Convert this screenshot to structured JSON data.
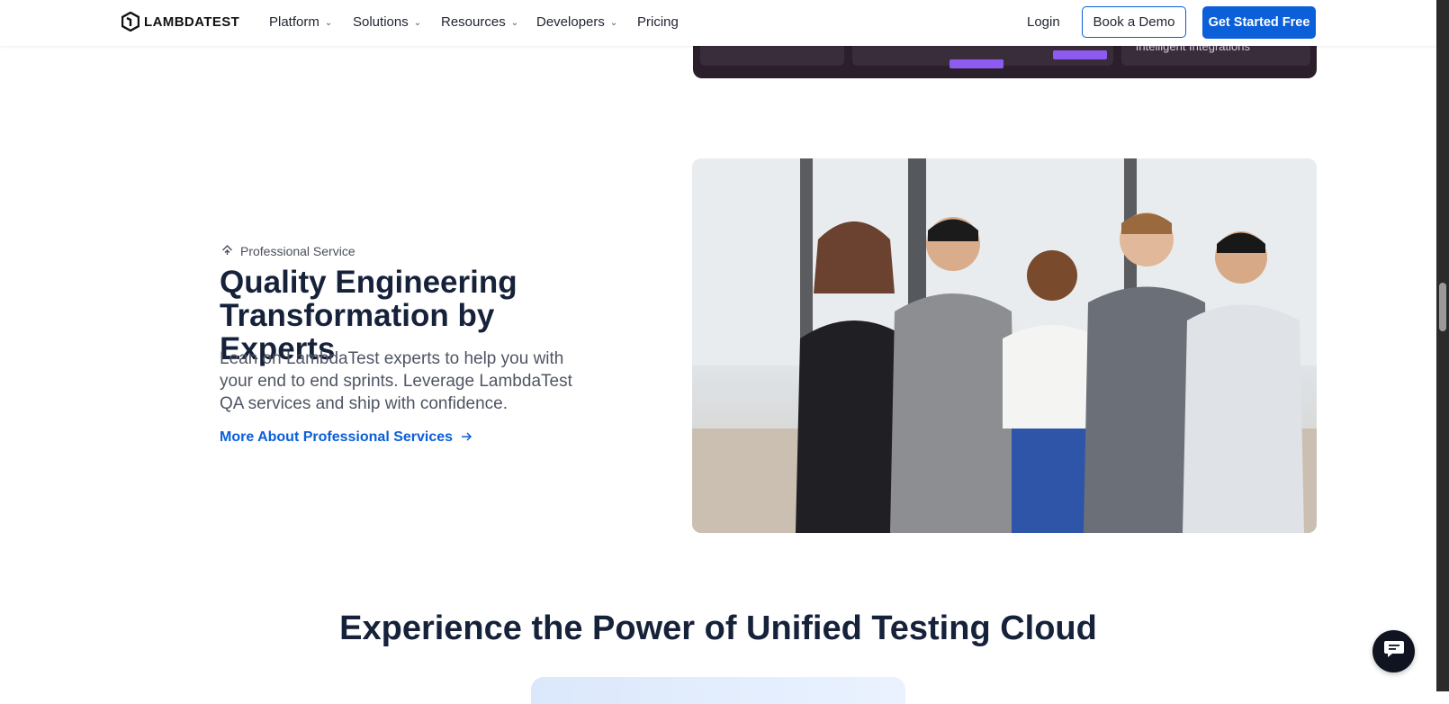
{
  "brand": {
    "name": "LAMBDATEST"
  },
  "nav": {
    "items": [
      {
        "label": "Platform",
        "has_dropdown": true
      },
      {
        "label": "Solutions",
        "has_dropdown": true
      },
      {
        "label": "Resources",
        "has_dropdown": true
      },
      {
        "label": "Developers",
        "has_dropdown": true
      },
      {
        "label": "Pricing",
        "has_dropdown": false
      }
    ],
    "login": "Login",
    "demo_button": "Book a Demo",
    "cta_button": "Get Started Free"
  },
  "top_image": {
    "caption": "Intelligent Integrations"
  },
  "feature": {
    "eyebrow": "Professional Service",
    "title": "Quality Engineering Transformation by Experts",
    "description": "Lean on LambdaTest experts to help you with your end to end sprints. Leverage LambdaTest QA services and ship with confidence.",
    "link": "More About Professional Services"
  },
  "section": {
    "title": "Experience the Power of Unified Testing Cloud"
  },
  "colors": {
    "accent": "#0b5fd8",
    "heading": "#16213a",
    "body_text": "#4f5563"
  },
  "icons": {
    "eyebrow": "service-icon",
    "link_arrow": "arrow-right-icon",
    "chat": "chat-icon",
    "dropdown": "chevron-down-icon"
  }
}
